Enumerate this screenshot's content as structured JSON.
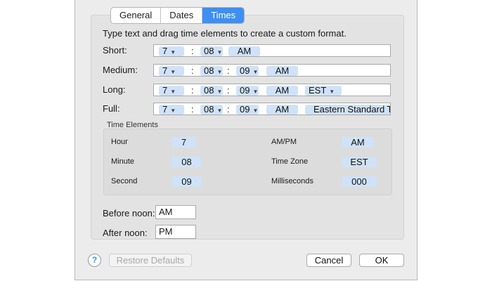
{
  "tabs": [
    {
      "label": "General",
      "active": false
    },
    {
      "label": "Dates",
      "active": false
    },
    {
      "label": "Times",
      "active": true
    }
  ],
  "instructions": "Type text and drag time elements to create a custom format.",
  "formats": {
    "short": {
      "label": "Short:",
      "tokens": [
        "7",
        ":",
        "08",
        "AM"
      ]
    },
    "medium": {
      "label": "Medium:",
      "tokens": [
        "7",
        ":",
        "08",
        ":",
        "09",
        "AM"
      ]
    },
    "long": {
      "label": "Long:",
      "tokens": [
        "7",
        ":",
        "08",
        ":",
        "09",
        "AM",
        "EST"
      ]
    },
    "full": {
      "label": "Full:",
      "tokens": [
        "7",
        ":",
        "08",
        ":",
        "09",
        "AM",
        "Eastern Standard Ti"
      ]
    }
  },
  "time_elements": {
    "title": "Time Elements",
    "hour": {
      "label": "Hour",
      "value": "7"
    },
    "minute": {
      "label": "Minute",
      "value": "08"
    },
    "second": {
      "label": "Second",
      "value": "09"
    },
    "ampm": {
      "label": "AM/PM",
      "value": "AM"
    },
    "timezone": {
      "label": "Time Zone",
      "value": "EST"
    },
    "milliseconds": {
      "label": "Milliseconds",
      "value": "000"
    }
  },
  "before_noon": {
    "label": "Before noon:",
    "value": "AM"
  },
  "after_noon": {
    "label": "After noon:",
    "value": "PM"
  },
  "buttons": {
    "help": "?",
    "restore": "Restore Defaults",
    "cancel": "Cancel",
    "ok": "OK"
  },
  "colors": {
    "accent": "#3d8ff4",
    "token": "#cfe2f8"
  }
}
